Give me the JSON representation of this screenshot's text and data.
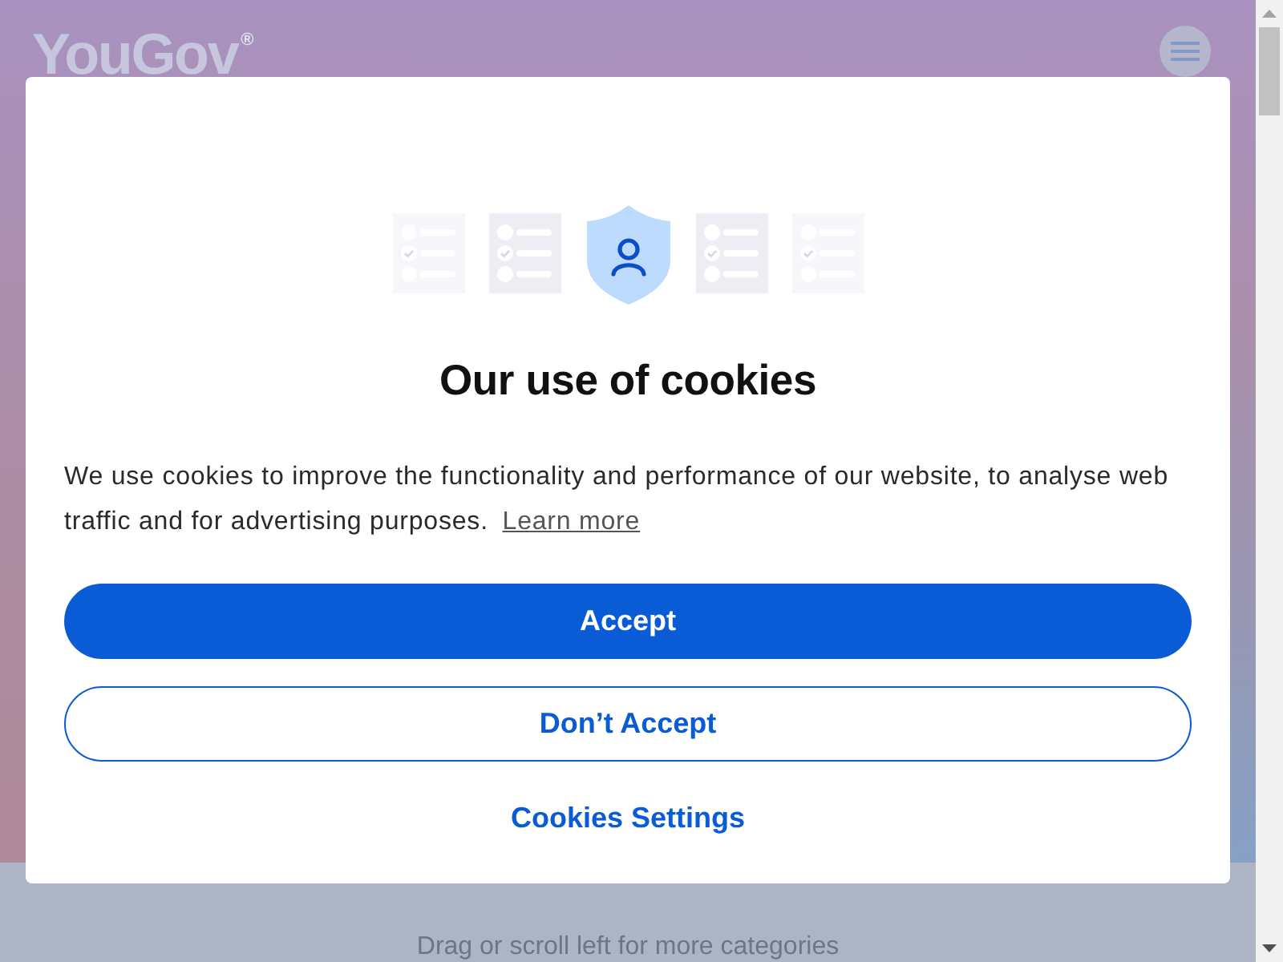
{
  "page": {
    "logo": "YouGov$^{®}$",
    "hint": "Drag or scroll left for more categories"
  },
  "dialog": {
    "title": "Our use of cookies",
    "message": "We use cookies to improve the functionality and performance of our website, to analyse web traffic and for advertising purposes.",
    "link": "Learn more",
    "buttons": [
      {
        "label": "Accept",
        "kind": "primary"
      },
      {
        "label": "Don’t Accept",
        "kind": "outline"
      },
      {
        "label": "Cookies Settings",
        "kind": "text"
      }
    ]
  }
}
